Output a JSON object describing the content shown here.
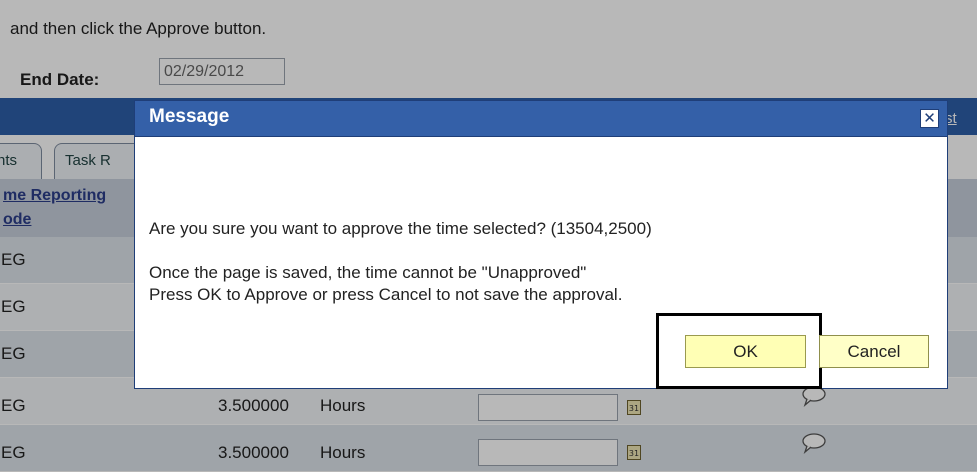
{
  "page": {
    "instruction": "and then click the Approve button.",
    "end_date_label": "End Date:",
    "end_date_value": "02/29/2012",
    "tab_1": "nts",
    "tab_2": "Task R",
    "column_header_line1": "me Reporting",
    "column_header_line2": "ode",
    "list_link": "st"
  },
  "rows": [
    {
      "code": "EG",
      "amount": "",
      "unit": ""
    },
    {
      "code": "EG",
      "amount": "",
      "unit": ""
    },
    {
      "code": "EG",
      "amount": "",
      "unit": ""
    },
    {
      "code": "EG",
      "amount": "3.500000",
      "unit": "Hours"
    },
    {
      "code": "EG",
      "amount": "3.500000",
      "unit": "Hours"
    }
  ],
  "dialog": {
    "title": "Message",
    "close_glyph": "✕",
    "question": "Are you sure you want to approve the time selected? (13504,2500)",
    "line2": "Once the page is saved,  the time cannot be \"Unapproved\"",
    "line3": "Press OK to Approve or press Cancel to not save the approval.",
    "ok_label": "OK",
    "cancel_label": "Cancel"
  },
  "icons": {
    "calendar": "calendar-icon",
    "comment": "comment-bubble-icon",
    "close": "close-icon"
  },
  "colors": {
    "title_bar": "#3460a8",
    "ok_button_fill": "#ffffb5",
    "cancel_button_fill": "#ffffc7"
  }
}
